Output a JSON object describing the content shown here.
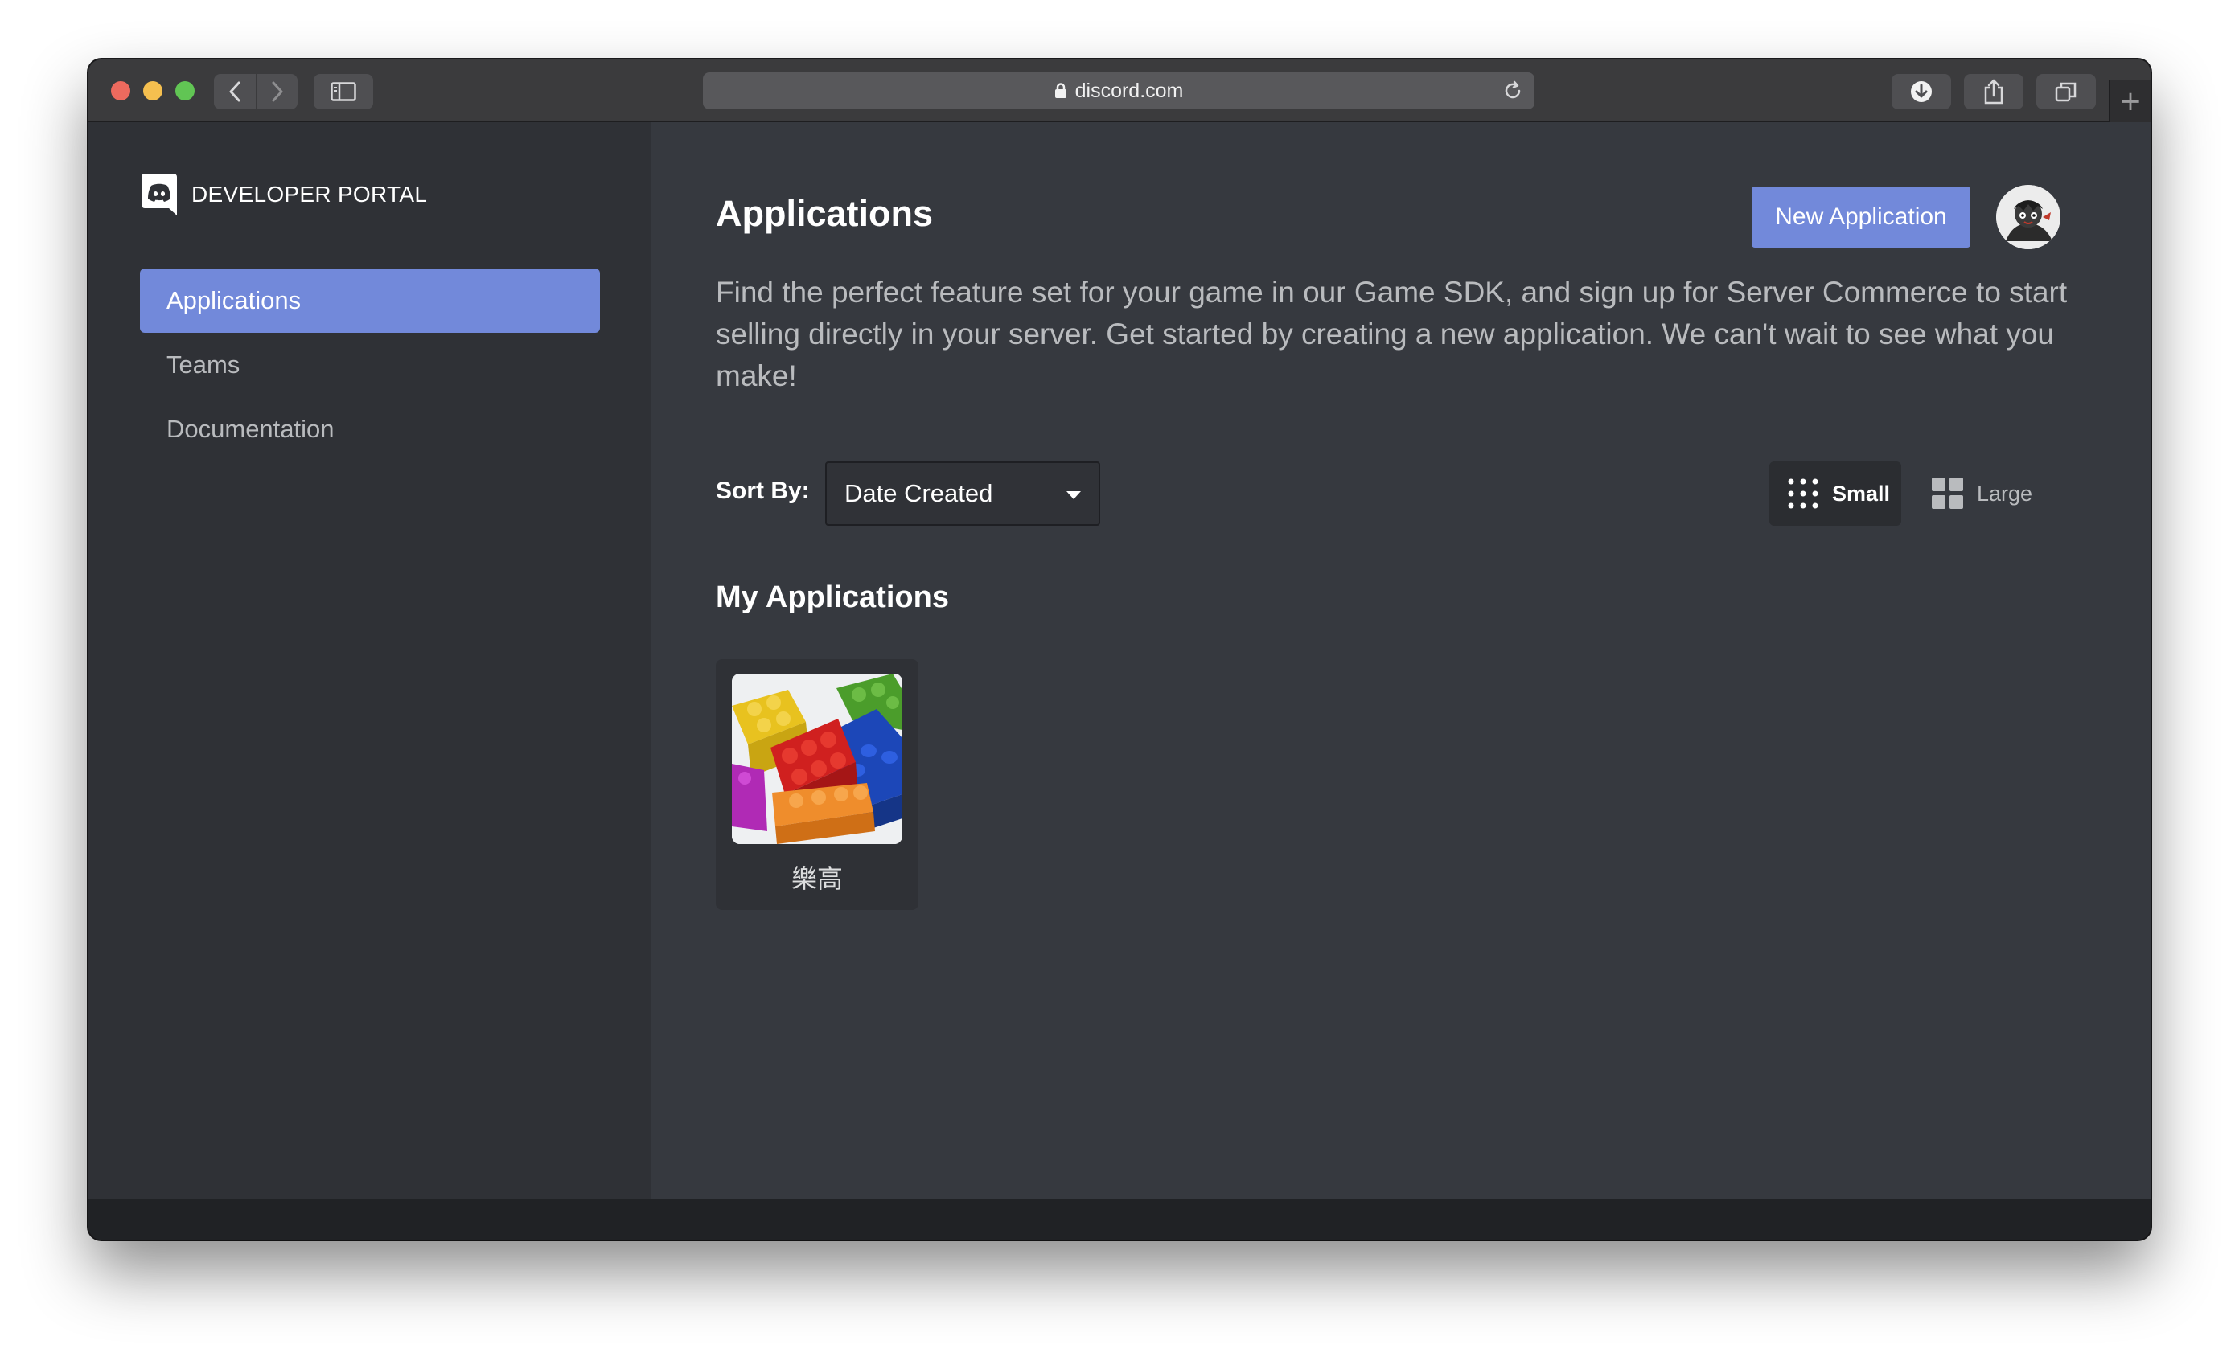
{
  "browser": {
    "url": "discord.com"
  },
  "brand": {
    "name": "DEVELOPER PORTAL"
  },
  "sidebar": {
    "items": [
      {
        "label": "Applications",
        "active": true
      },
      {
        "label": "Teams",
        "active": false
      },
      {
        "label": "Documentation",
        "active": false
      }
    ]
  },
  "header": {
    "title": "Applications",
    "new_button": "New Application",
    "description": "Find the perfect feature set for your game in our Game SDK, and sign up for Server Commerce to start selling directly in your server. Get started by creating a new application. We can't wait to see what you make!"
  },
  "sort": {
    "label": "Sort By:",
    "selected": "Date Created"
  },
  "view_size": {
    "small": "Small",
    "large": "Large",
    "selected": "small"
  },
  "applications": {
    "title": "My Applications",
    "items": [
      {
        "name": "樂高"
      }
    ]
  },
  "colors": {
    "accent": "#7289da",
    "sidebar_bg": "#2f3136",
    "main_bg": "#36393f"
  },
  "icons": {
    "brand": "discord-logo-icon",
    "lock": "lock-icon",
    "reload": "reload-icon",
    "small_view": "dot-grid-icon",
    "large_view": "square-grid-icon"
  }
}
